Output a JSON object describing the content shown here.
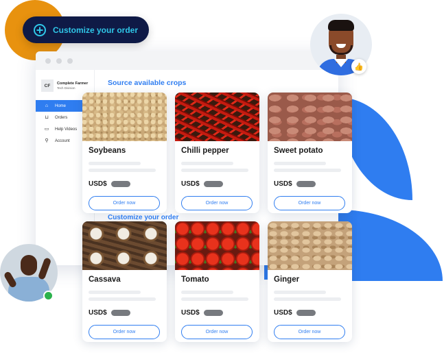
{
  "colors": {
    "accent": "#2f7df0",
    "pill_bg": "#0f1a46",
    "pill_text": "#2fc7e8",
    "orange": "#e8920f",
    "online": "#2bb24c"
  },
  "hero_pill": {
    "label": "Customize your order",
    "icon": "plus-circle-icon"
  },
  "brand": {
    "logo": "CF",
    "name": "Complete Farmer",
    "subtitle": "Tech Division"
  },
  "sidebar": {
    "items": [
      {
        "label": "Home",
        "icon": "home-icon",
        "active": true
      },
      {
        "label": "Orders",
        "icon": "basket-icon",
        "active": false
      },
      {
        "label": "Help Videos",
        "icon": "video-icon",
        "active": false
      },
      {
        "label": "Account",
        "icon": "user-icon",
        "active": false
      }
    ]
  },
  "main": {
    "source_title": "Source available crops",
    "customize_title": "Customize your order"
  },
  "products": [
    {
      "name": "Soybeans",
      "currency": "USD$",
      "button": "Order now"
    },
    {
      "name": "Chilli pepper",
      "currency": "USD$",
      "button": "Order now"
    },
    {
      "name": "Sweet potato",
      "currency": "USD$",
      "button": "Order now"
    },
    {
      "name": "Cassava",
      "currency": "USD$",
      "button": "Order now"
    },
    {
      "name": "Tomato",
      "currency": "USD$",
      "button": "Order now"
    },
    {
      "name": "Ginger",
      "currency": "USD$",
      "button": "Order now"
    }
  ],
  "badges": {
    "thumb": "thumbs-up-icon"
  }
}
